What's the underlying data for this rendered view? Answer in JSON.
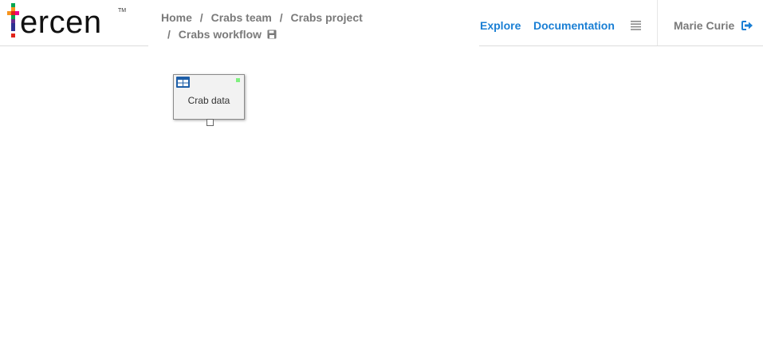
{
  "app": {
    "logo_text": "ercen",
    "logo_trademark": "TM",
    "brand_colors": [
      "#e2231a",
      "#f7941d",
      "#2e3192",
      "#00a651",
      "#662d91",
      "#ec008c"
    ]
  },
  "breadcrumb": {
    "items": [
      "Home",
      "Crabs team",
      "Crabs project"
    ],
    "current": "Crabs workflow",
    "separator": "/",
    "current_icon": "save-icon"
  },
  "nav": {
    "explore_label": "Explore",
    "documentation_label": "Documentation",
    "menu_icon": "hamburger-menu-icon",
    "link_color": "#1a7fd4"
  },
  "user": {
    "name": "Marie Curie",
    "logout_icon": "sign-out-icon"
  },
  "workflow": {
    "nodes": [
      {
        "label": "Crab data",
        "icon": "table-icon",
        "status_color": "#7ff07f"
      }
    ]
  }
}
